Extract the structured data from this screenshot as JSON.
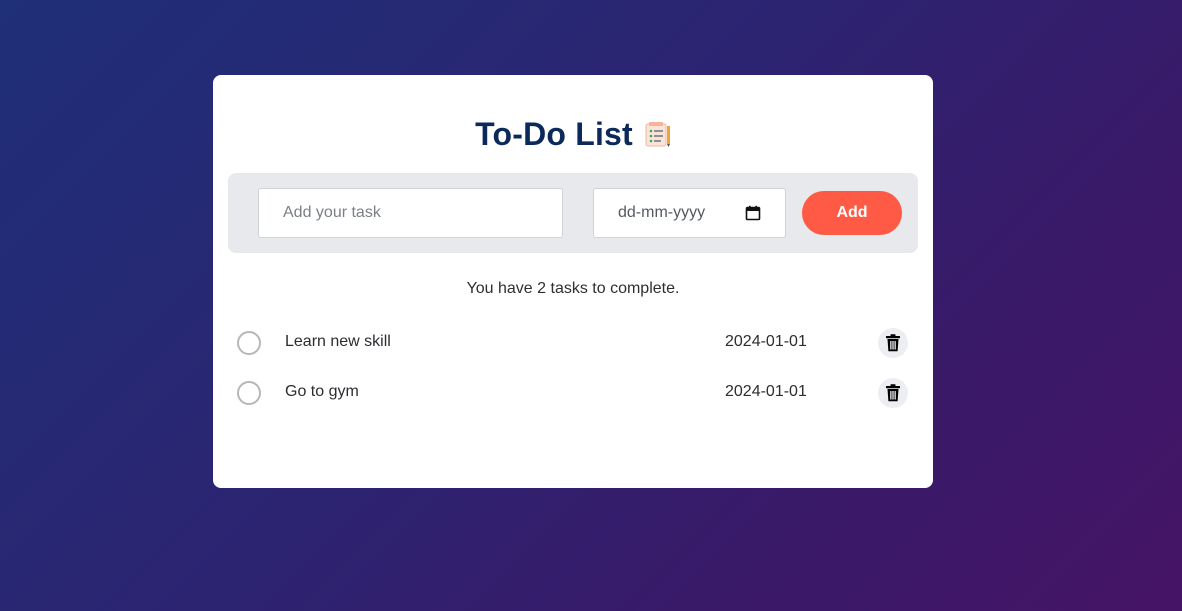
{
  "app": {
    "title": "To-Do List",
    "title_icon": "checklist-notepad-icon"
  },
  "form": {
    "task_placeholder": "Add your task",
    "task_value": "",
    "date_placeholder": "dd-mm-yyyy",
    "date_icon": "calendar-icon",
    "add_label": "Add"
  },
  "status": {
    "message": "You have 2 tasks to complete."
  },
  "tasks": [
    {
      "name": "Learn new skill",
      "date": "2024-01-01",
      "completed": false,
      "delete_icon": "trash-icon"
    },
    {
      "name": "Go to gym",
      "date": "2024-01-01",
      "completed": false,
      "delete_icon": "trash-icon"
    }
  ],
  "colors": {
    "accent": "#ff5a45",
    "title": "#0b2a5b",
    "background_start": "#1f2f78",
    "background_end": "#461467"
  }
}
